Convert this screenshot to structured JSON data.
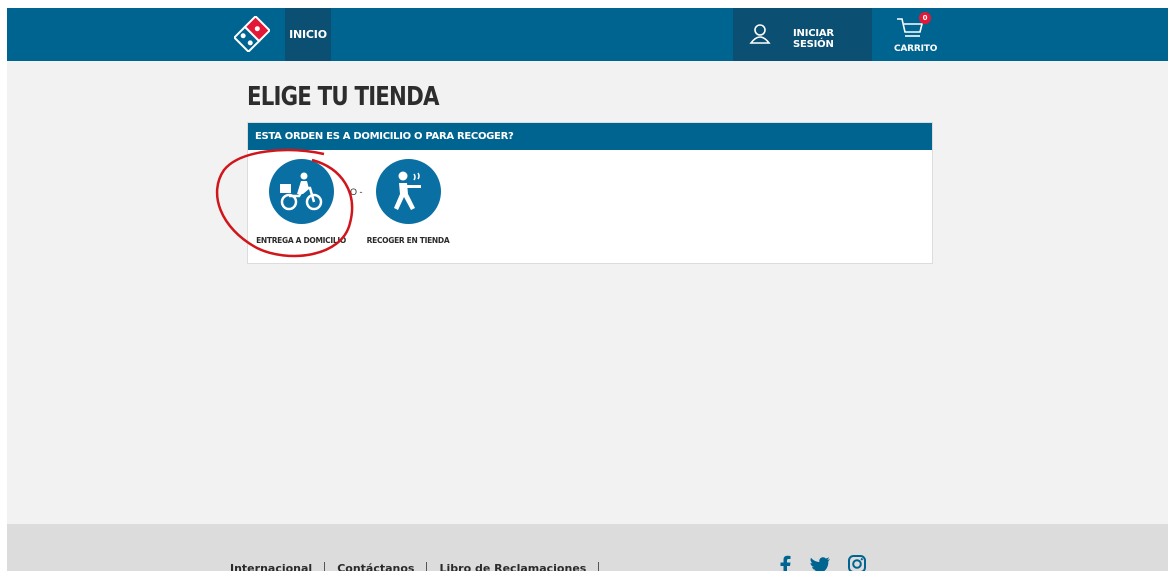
{
  "header": {
    "nav_home": "INICIO",
    "login_label": "INICIAR SESIÓN",
    "cart_label": "CARRITO",
    "cart_count": "0"
  },
  "main": {
    "title": "ELIGE TU TIENDA",
    "panel_question": "ESTA ORDEN ES A DOMICILIO O PARA RECOGER?",
    "or_text": "O -",
    "options": [
      {
        "label": "ENTREGA A DOMICILIO",
        "icon": "delivery-scooter-icon"
      },
      {
        "label": "RECOGER EN TIENDA",
        "icon": "carryout-person-icon"
      }
    ]
  },
  "footer": {
    "links": [
      "Internacional",
      "Contáctanos",
      "Libro de Reclamaciones"
    ],
    "social": [
      "facebook-icon",
      "twitter-icon",
      "instagram-icon"
    ]
  },
  "colors": {
    "brand_blue": "#006491",
    "dark_blue": "#0b4f73",
    "brand_red": "#e31837",
    "annotation_red": "#d0161b"
  }
}
